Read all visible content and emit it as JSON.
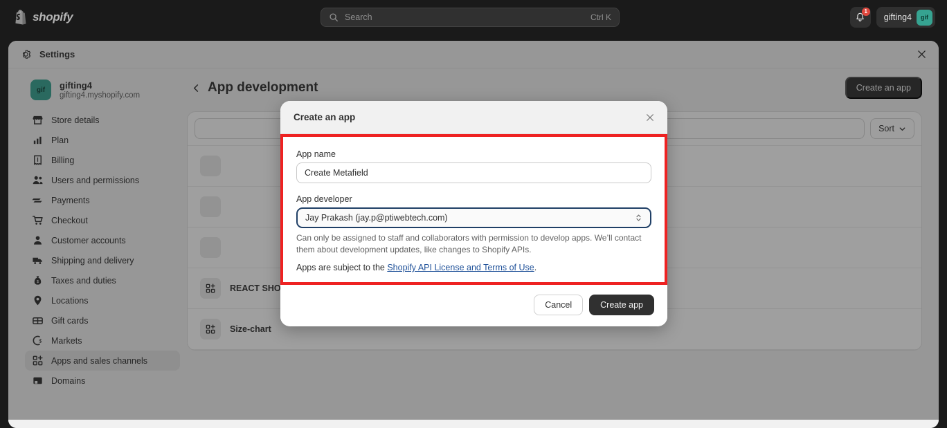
{
  "topbar": {
    "brand": "shopify",
    "brand_icon": "shopify-bag-icon",
    "search": {
      "icon": "search-icon",
      "placeholder": "Search",
      "shortcut": "Ctrl K",
      "value": ""
    },
    "notifications": {
      "icon": "bell-icon",
      "badge_count": "1"
    },
    "user": {
      "name": "gifting4",
      "avatar_initials": "gif"
    }
  },
  "settings_window": {
    "icon": "gear-icon",
    "title": "Settings",
    "close_icon": "close-icon"
  },
  "sidebar": {
    "store": {
      "avatar_initials": "gif",
      "name": "gifting4",
      "domain": "gifting4.myshopify.com"
    },
    "items": [
      {
        "label": "Store details",
        "icon": "store-icon",
        "active": false
      },
      {
        "label": "Plan",
        "icon": "chart-bars-icon",
        "active": false
      },
      {
        "label": "Billing",
        "icon": "receipt-icon",
        "active": false
      },
      {
        "label": "Users and permissions",
        "icon": "users-icon",
        "active": false
      },
      {
        "label": "Payments",
        "icon": "payments-icon",
        "active": false
      },
      {
        "label": "Checkout",
        "icon": "cart-icon",
        "active": false
      },
      {
        "label": "Customer accounts",
        "icon": "person-icon",
        "active": false
      },
      {
        "label": "Shipping and delivery",
        "icon": "truck-icon",
        "active": false
      },
      {
        "label": "Taxes and duties",
        "icon": "tax-bag-icon",
        "active": false
      },
      {
        "label": "Locations",
        "icon": "pin-icon",
        "active": false
      },
      {
        "label": "Gift cards",
        "icon": "gift-card-icon",
        "active": false
      },
      {
        "label": "Markets",
        "icon": "globe-currency-icon",
        "active": false
      },
      {
        "label": "Apps and sales channels",
        "icon": "apps-grid-icon",
        "active": true
      },
      {
        "label": "Domains",
        "icon": "domain-icon",
        "active": false
      }
    ]
  },
  "main": {
    "back_icon": "chevron-left-icon",
    "page_title": "App development",
    "create_app_button": "Create an app",
    "toolbar": {
      "filter_value": "",
      "sort_label": "Sort",
      "sort_icon": "chevron-down-icon"
    },
    "app_rows": [
      {
        "title": "",
        "icon": "app-placeholder-icon"
      },
      {
        "title": "",
        "icon": "app-placeholder-icon"
      },
      {
        "title": "",
        "icon": "app-placeholder-icon"
      },
      {
        "title": "REACT SHOPIFY",
        "icon": "app-placeholder-icon"
      },
      {
        "title": "Size-chart",
        "icon": "app-placeholder-icon"
      }
    ]
  },
  "dialog": {
    "title": "Create an app",
    "close_icon": "close-icon",
    "app_name": {
      "label": "App name",
      "value": "Create Metafield",
      "placeholder": ""
    },
    "app_developer": {
      "label": "App developer",
      "selected": "Jay Prakash (jay.p@ptiwebtech.com)",
      "chevron_icon": "select-updown-icon",
      "help_text": "Can only be assigned to staff and collaborators with permission to develop apps. We’ll contact them about development updates, like changes to Shopify APIs."
    },
    "terms": {
      "prefix": "Apps are subject to the ",
      "link": "Shopify API License and Terms of Use",
      "suffix": "."
    },
    "cancel_button": "Cancel",
    "create_button": "Create app"
  },
  "annotation": {
    "highlight_color": "#ee2222"
  },
  "colors": {
    "topbar_bg": "#1a1a1a",
    "accent_teal": "#36a391",
    "badge_red": "#e0483e",
    "link_blue": "#1f5199",
    "button_dark": "#303030",
    "focus_ring": "#1f3f66"
  }
}
